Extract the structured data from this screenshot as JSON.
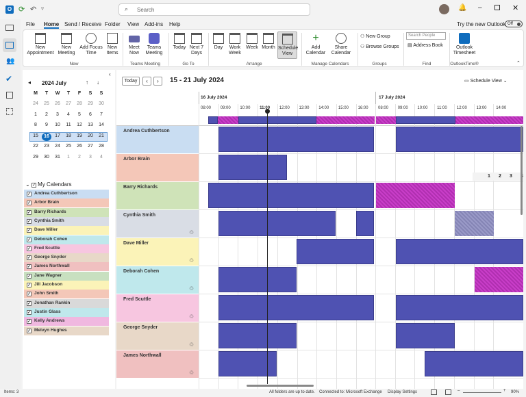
{
  "titlebar": {
    "search_placeholder": "Search",
    "try_new": "Try the new Outlook",
    "toggle": "Off"
  },
  "menu": [
    "File",
    "Home",
    "Send / Receive",
    "Folder",
    "View",
    "Add-ins",
    "Help"
  ],
  "ribbon": {
    "new_appointment": "New\nAppointment",
    "new_meeting": "New\nMeeting",
    "add_focus": "Add Focus\nTime",
    "new_items": "New\nItems",
    "group_new": "New",
    "meet_now": "Meet\nNow",
    "teams_meeting": "Teams\nMeeting",
    "group_teams": "Teams Meeting",
    "today": "Today",
    "next7": "Next 7\nDays",
    "group_goto": "Go To",
    "day": "Day",
    "work_week": "Work\nWeek",
    "week": "Week",
    "month": "Month",
    "schedule_view": "Schedule\nView",
    "group_arrange": "Arrange",
    "add_calendar": "Add\nCalendar",
    "share_calendar": "Share\nCalendar",
    "group_manage": "Manage Calendars",
    "new_group": "New Group",
    "browse_groups": "Browse Groups",
    "group_groups": "Groups",
    "search_people": "Search People",
    "address_book": "Address Book",
    "group_find": "Find",
    "outlook_timesheet": "Outlook\nTimesheet",
    "group_outlooktime": "OutlookTime®"
  },
  "minical": {
    "title": "2024 July",
    "dow": [
      "M",
      "T",
      "W",
      "T",
      "F",
      "S",
      "S"
    ],
    "weeks": [
      [
        "24",
        "25",
        "26",
        "27",
        "28",
        "29",
        "30"
      ],
      [
        "1",
        "2",
        "3",
        "4",
        "5",
        "6",
        "7"
      ],
      [
        "8",
        "9",
        "10",
        "11",
        "12",
        "13",
        "14"
      ],
      [
        "15",
        "16",
        "17",
        "18",
        "19",
        "20",
        "21"
      ],
      [
        "22",
        "23",
        "24",
        "25",
        "26",
        "27",
        "28"
      ],
      [
        "29",
        "30",
        "31",
        "1",
        "2",
        "3",
        "4"
      ]
    ],
    "today": "16"
  },
  "my_calendars": {
    "label": "My Calendars",
    "items": [
      {
        "name": "Andrea Cuthbertson",
        "color": "#c9ddf2"
      },
      {
        "name": "Arbor Brain",
        "color": "#f4c7b8"
      },
      {
        "name": "Barry Richards",
        "color": "#cfe3b8"
      },
      {
        "name": "Cynthia Smith",
        "color": "#d9dde5"
      },
      {
        "name": "Dave Miller",
        "color": "#fbf3b8"
      },
      {
        "name": "Deborah Cohen",
        "color": "#bfe8ec"
      },
      {
        "name": "Fred Scuttle",
        "color": "#f7c6e0"
      },
      {
        "name": "George Snyder",
        "color": "#e8d8c8"
      },
      {
        "name": "James Northwall",
        "color": "#f0c0c0"
      },
      {
        "name": "Jane Wagner",
        "color": "#c8e0c0"
      },
      {
        "name": "Jill Jacobson",
        "color": "#fbf3b8"
      },
      {
        "name": "John Smith",
        "color": "#f4c7b8"
      },
      {
        "name": "Jonathan Rankin",
        "color": "#d9d9d9"
      },
      {
        "name": "Justin Glass",
        "color": "#bfe8ec"
      },
      {
        "name": "Kelly Andrews",
        "color": "#f0b8e0"
      },
      {
        "name": "Melvyn Hughes",
        "color": "#e8d8c8"
      }
    ]
  },
  "schedule": {
    "today_btn": "Today",
    "range": "15 - 21 July 2024",
    "view": "Schedule View",
    "day1": "16 July 2024",
    "day2": "17 July 2024",
    "hours1": [
      "08:00",
      "09:00",
      "10:00",
      "11:00",
      "12:00",
      "13:00",
      "14:00",
      "15:00",
      "16:00"
    ],
    "hours2": [
      "08:00",
      "09:00",
      "10:00",
      "11:00",
      "12:00",
      "13:00",
      "14:00"
    ],
    "pages": [
      "1",
      "2",
      "3",
      "4"
    ],
    "rows": [
      "Andrea Cuthbertson",
      "Arbor Brain",
      "Barry Richards",
      "Cynthia Smith",
      "Dave Miller",
      "Deborah Cohen",
      "Fred Scuttle",
      "George Snyder",
      "James Northwall"
    ]
  },
  "status": {
    "items": "Items: 3",
    "sync": "All folders are up to date.",
    "connected": "Connected to: Microsoft Exchange",
    "display": "Display Settings",
    "zoom": "90%"
  }
}
